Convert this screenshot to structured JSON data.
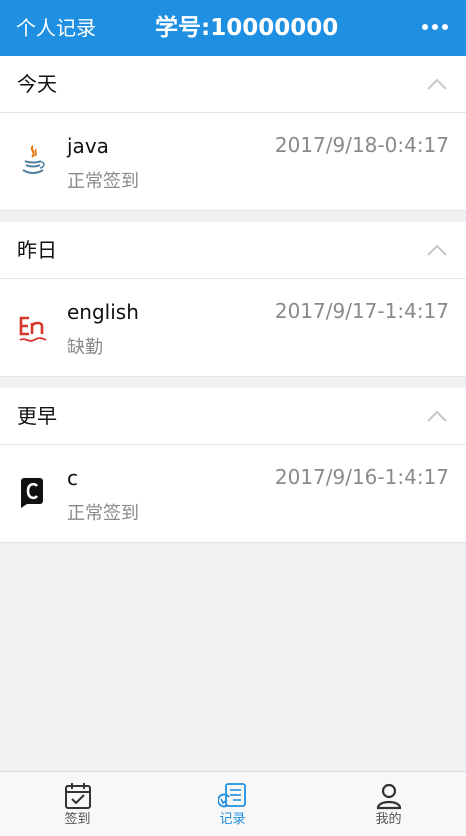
{
  "header": {
    "left_title": "个人记录",
    "title": "学号:10000000",
    "more_icon": "more-horizontal-icon",
    "background": "#1e8fe1"
  },
  "sections": [
    {
      "title": "今天",
      "items": [
        {
          "icon": "java-logo-icon",
          "course": "java",
          "time": "2017/9/18-0:4:17",
          "status": "正常签到"
        }
      ]
    },
    {
      "title": "昨日",
      "items": [
        {
          "icon": "english-logo-icon",
          "course": "english",
          "time": "2017/9/17-1:4:17",
          "status": "缺勤"
        }
      ]
    },
    {
      "title": "更早",
      "items": [
        {
          "icon": "c-language-icon",
          "course": "c",
          "time": "2017/9/16-1:4:17",
          "status": "正常签到"
        }
      ]
    }
  ],
  "tabbar": {
    "tabs": [
      {
        "label": "签到",
        "icon": "calendar-check-icon",
        "active": false
      },
      {
        "label": "记录",
        "icon": "records-icon",
        "active": true
      },
      {
        "label": "我的",
        "icon": "user-icon",
        "active": false
      }
    ],
    "active_color": "#1e8fe1"
  }
}
